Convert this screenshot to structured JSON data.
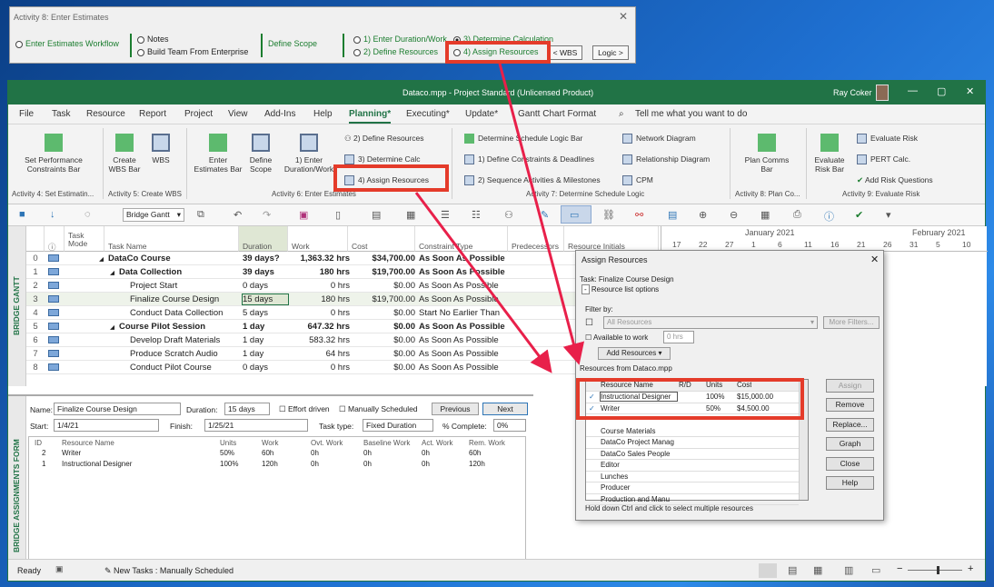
{
  "panel": {
    "title": "Activity 8: Enter Estimates",
    "enter_workflow": "Enter Estimates Workflow",
    "notes": "Notes",
    "build_team": "Build Team From Enterprise",
    "define_scope": "Define Scope",
    "enter_duration": "1) Enter Duration/Work",
    "define_resources": "2) Define Resources",
    "determine_calc": "3) Determine Calculation",
    "assign_resources": "4) Assign Resources",
    "wbs_btn": "< WBS",
    "logic_btn": "Logic >"
  },
  "window": {
    "title": "Dataco.mpp - Project Standard (Unlicensed Product)",
    "user": "Ray Coker"
  },
  "tabs": [
    "File",
    "Task",
    "Resource",
    "Report",
    "Project",
    "View",
    "Add-Ins",
    "Help",
    "Planning*",
    "Executing*",
    "Update*",
    "Gantt Chart Format"
  ],
  "tell_me": "Tell me what you want to do",
  "ribbon": {
    "set_perf": "Set Performance Constraints Bar",
    "create_wbs": "Create WBS Bar",
    "wbs": "WBS",
    "enter_est": "Enter Estimates Bar",
    "define_scope": "Define Scope",
    "enter_dur": "1) Enter Duration/Work",
    "define_res": "2) Define Resources",
    "determine_calc": "3) Determine Calc",
    "assign_res": "4) Assign Resources",
    "det_logic": "Determine Schedule Logic Bar",
    "constraints": "1) Define Constraints & Deadlines",
    "sequence": "2) Sequence Activities & Milestones",
    "network": "Network Diagram",
    "relationship": "Relationship Diagram",
    "cpm": "CPM",
    "plan_comms": "Plan Comms Bar",
    "eval_risk_bar": "Evaluate Risk Bar",
    "eval_risk": "Evaluate Risk",
    "pert": "PERT Calc.",
    "add_risk": "Add Risk Questions",
    "g4": "Activity 4: Set Estimatin...",
    "g5": "Activity 5: Create WBS",
    "g6": "Activity 6: Enter Estimates",
    "g7": "Activity 7: Determine Schedule Logic",
    "g8": "Activity 8: Plan Co...",
    "g9": "Activity 9: Evaluate Risk"
  },
  "view_select": "Bridge Gantt",
  "grid": {
    "view_label": "BRIDGE GANTT",
    "headers": [
      "Task Mode",
      "Task Name",
      "Duration",
      "Work",
      "Cost",
      "Constraint Type",
      "Predecessors",
      "Resource Initials"
    ],
    "rows": [
      {
        "id": "0",
        "name": "DataCo Course",
        "dur": "39 days?",
        "work": "1,363.32 hrs",
        "cost": "$34,700.00",
        "con": "As Soon As Possible",
        "bold": true,
        "indent": 0
      },
      {
        "id": "1",
        "name": "Data Collection",
        "dur": "39 days",
        "work": "180 hrs",
        "cost": "$19,700.00",
        "con": "As Soon As Possible",
        "bold": true,
        "indent": 1
      },
      {
        "id": "2",
        "name": "Project Start",
        "dur": "0 days",
        "work": "0 hrs",
        "cost": "$0.00",
        "con": "As Soon As Possible",
        "bold": false,
        "indent": 2
      },
      {
        "id": "3",
        "name": "Finalize Course Design",
        "dur": "15 days",
        "work": "180 hrs",
        "cost": "$19,700.00",
        "con": "As Soon As Possible",
        "bold": false,
        "indent": 2
      },
      {
        "id": "4",
        "name": "Conduct Data Collection",
        "dur": "5 days",
        "work": "0 hrs",
        "cost": "$0.00",
        "con": "Start No Earlier Than",
        "bold": false,
        "indent": 2
      },
      {
        "id": "5",
        "name": "Course Pilot Session",
        "dur": "1 day",
        "work": "647.32 hrs",
        "cost": "$0.00",
        "con": "As Soon As Possible",
        "bold": true,
        "indent": 1
      },
      {
        "id": "6",
        "name": "Develop Draft Materials",
        "dur": "1 day",
        "work": "583.32 hrs",
        "cost": "$0.00",
        "con": "As Soon As Possible",
        "bold": false,
        "indent": 2
      },
      {
        "id": "7",
        "name": "Produce Scratch Audio",
        "dur": "1 day",
        "work": "64 hrs",
        "cost": "$0.00",
        "con": "As Soon As Possible",
        "bold": false,
        "indent": 2
      },
      {
        "id": "8",
        "name": "Conduct Pilot Course",
        "dur": "0 days",
        "work": "0 hrs",
        "cost": "$0.00",
        "con": "As Soon As Possible",
        "bold": false,
        "indent": 2
      }
    ]
  },
  "gantt": {
    "months": [
      "January 2021",
      "February 2021"
    ],
    "ticks": [
      "17",
      "22",
      "27",
      "1",
      "6",
      "11",
      "16",
      "21",
      "26",
      "31",
      "5",
      "10"
    ]
  },
  "form": {
    "view_label": "BRIDGE ASSIGNMENTS FORM",
    "name_label": "Name:",
    "name_val": "Finalize Course Design",
    "duration_label": "Duration:",
    "duration_val": "15 days",
    "effort": "Effort driven",
    "manual": "Manually Scheduled",
    "prev": "Previous",
    "next": "Next",
    "start_label": "Start:",
    "start_val": "1/4/21",
    "finish_label": "Finish:",
    "finish_val": "1/25/21",
    "tasktype_label": "Task type:",
    "tasktype_val": "Fixed Duration",
    "complete_label": "% Complete:",
    "complete_val": "0%",
    "cols": [
      "ID",
      "Resource Name",
      "Units",
      "Work",
      "Ovt. Work",
      "Baseline Work",
      "Act. Work",
      "Rem. Work"
    ],
    "rows": [
      [
        "2",
        "Writer",
        "50%",
        "60h",
        "0h",
        "0h",
        "0h",
        "60h"
      ],
      [
        "1",
        "Instructional Designer",
        "100%",
        "120h",
        "0h",
        "0h",
        "0h",
        "120h"
      ]
    ]
  },
  "status": {
    "ready": "Ready",
    "new_tasks": "New Tasks : Manually Scheduled"
  },
  "dialog": {
    "title": "Assign Resources",
    "task": "Task: Finalize Course Design",
    "res_opts": "Resource list options",
    "filter": "Filter by:",
    "all_res": "All Resources",
    "more_filters": "More Filters...",
    "available": "Available to work",
    "hrs": "0 hrs",
    "add_res": "Add Resources",
    "from": "Resources from Dataco.mpp",
    "cols": [
      "Resource Name",
      "R/D",
      "Units",
      "Cost"
    ],
    "assigned": [
      [
        "Instructional Designer",
        "",
        "100%",
        "$15,000.00"
      ],
      [
        "Writer",
        "",
        "50%",
        "$4,500.00"
      ]
    ],
    "others": [
      "Course Materials",
      "DataCo Project Manag",
      "DataCo Sales People",
      "Editor",
      "Lunches",
      "Producer",
      "Production and Manu"
    ],
    "buttons": [
      "Assign",
      "Remove",
      "Replace...",
      "Graph",
      "Close",
      "Help"
    ],
    "hint": "Hold down Ctrl and click to select multiple resources"
  }
}
